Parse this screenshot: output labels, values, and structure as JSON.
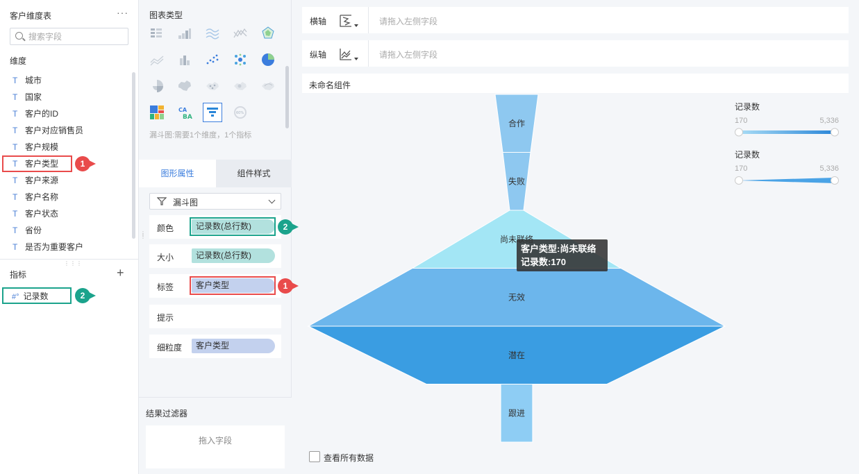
{
  "left_panel": {
    "title": "客户维度表",
    "more": "···",
    "search_placeholder": "搜索字段",
    "dimension_label": "维度",
    "dimensions": [
      "城市",
      "国家",
      "客户的ID",
      "客户对应销售员",
      "客户规模",
      "客户类型",
      "客户来源",
      "客户名称",
      "客户状态",
      "省份",
      "是否为重要客户"
    ],
    "dimension_type_glyph": "T",
    "measure_label": "指标",
    "measure_type_glyph": "#°",
    "measures": [
      "记录数"
    ]
  },
  "chart_types": {
    "title": "图表类型",
    "hint": "漏斗图:需要1个维度，1个指标",
    "selected": "funnel-chart",
    "icons": [
      "pivot-table-icon",
      "bar-chart-icon",
      "line-chart-icon",
      "cross-line-icon",
      "radar-icon",
      "area-chart-icon",
      "column-chart-icon",
      "scatter-icon",
      "bubble-icon",
      "pie-chart-icon",
      "rose-chart-icon",
      "china-map-icon",
      "point-map-icon",
      "heat-map-icon",
      "flow-map-icon",
      "treemap-icon",
      "word-cloud-icon",
      "funnel-chart-icon",
      "gauge-icon"
    ],
    "gauge_text": "60%",
    "wordcloud_text": "CABA"
  },
  "tabs": {
    "active": "图形属性",
    "inactive": "组件样式"
  },
  "chart_select": {
    "value": "漏斗图"
  },
  "properties": [
    {
      "label": "颜色",
      "value": "记录数(总行数)"
    },
    {
      "label": "大小",
      "value": "记录数(总行数)"
    },
    {
      "label": "标签",
      "value": "客户类型"
    },
    {
      "label": "提示",
      "value": ""
    },
    {
      "label": "细粒度",
      "value": "客户类型"
    }
  ],
  "filter": {
    "title": "结果过滤器",
    "placeholder": "拖入字段"
  },
  "axes": {
    "x_label": "横轴",
    "y_label": "纵轴",
    "placeholder": "请拖入左侧字段"
  },
  "component_title": "未命名组件",
  "legends": [
    {
      "title": "记录数",
      "min": "170",
      "max": "5,336"
    },
    {
      "title": "记录数",
      "min": "170",
      "max": "5,336"
    }
  ],
  "tooltip": {
    "line1": "客户类型:尚未联络",
    "line2": "记录数:170"
  },
  "view_all_label": "查看所有数据",
  "annotations": {
    "one": "1",
    "two": "2"
  },
  "colors": {
    "accent": "#3b7ddd",
    "red_highlight": "#e94b4b",
    "green_highlight": "#1ba38c"
  },
  "chart_data": {
    "type": "funnel",
    "categories": [
      "合作",
      "失败",
      "尚未联络",
      "无效",
      "潜在",
      "跟进"
    ],
    "values": [
      350,
      350,
      1000,
      5336,
      5336,
      170
    ],
    "legend": "top-right"
  }
}
